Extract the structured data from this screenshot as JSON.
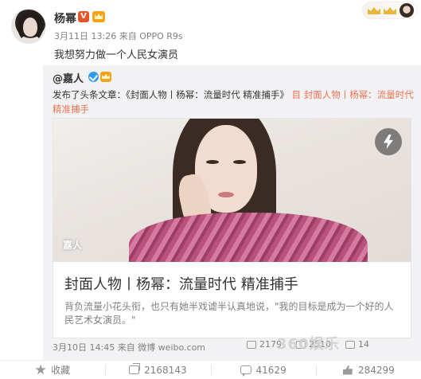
{
  "post": {
    "username": "杨幂",
    "vip_badge": "V",
    "date": "3月11日 13:26",
    "source_prefix": "来自",
    "source": "OPPO R9s",
    "text": "我想努力做一个人民女演员"
  },
  "repost": {
    "author": "@嘉人",
    "desc_prefix": "发布了头条文章：《封面人物丨杨幂：流量时代 精准捕手》",
    "desc_link": "目 封面人物丨杨幂：流量时代 精准捕手",
    "card": {
      "watermark": "嘉人",
      "title": "封面人物丨杨幂：流量时代 精准捕手",
      "summary": "背负流量小花头衔，也只有她半戏谑半认真地说，\"我的目标是成为一个好的人民艺术女演员。\""
    },
    "meta": "3月10日 14:45 来自 微博 weibo.com",
    "stats": [
      {
        "icon": "share-icon",
        "value": "2179"
      },
      {
        "icon": "comment-icon",
        "value": "2510"
      },
      {
        "icon": "like-icon",
        "value": "14"
      }
    ]
  },
  "actions": [
    {
      "name": "favorite",
      "icon": "star-icon",
      "label": "收藏"
    },
    {
      "name": "repost",
      "icon": "share-icon",
      "label": "2168143"
    },
    {
      "name": "comment",
      "icon": "comment-icon",
      "label": "41629"
    },
    {
      "name": "like",
      "icon": "like-icon",
      "label": "284299"
    }
  ],
  "watermark_text": "360娱乐",
  "colors": {
    "accent_link": "#eb7350",
    "muted_text": "#808080",
    "repost_bg": "#f2f2f5"
  }
}
